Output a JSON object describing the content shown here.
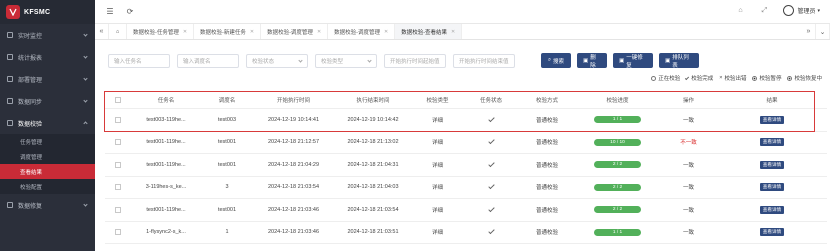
{
  "app": {
    "logo": "KFSMC"
  },
  "sidebar": {
    "items": [
      {
        "label": "实时监控"
      },
      {
        "label": "统计报表"
      },
      {
        "label": "部署管理"
      },
      {
        "label": "数据同步"
      },
      {
        "label": "数据校验"
      },
      {
        "label": "数据修复"
      }
    ],
    "sub_items": [
      {
        "label": "任务管理"
      },
      {
        "label": "调度管理"
      },
      {
        "label": "查看结果"
      },
      {
        "label": "校验配置"
      }
    ]
  },
  "topbar": {
    "user": "管理员"
  },
  "tabs": [
    {
      "label": "数据校验-任务管理"
    },
    {
      "label": "数据校验-新建任务"
    },
    {
      "label": "数据校验-调度管理"
    },
    {
      "label": "数据校验-调度管理"
    },
    {
      "label": "数据校验-查看结果"
    }
  ],
  "filters": {
    "task_name": "输入任务名",
    "sched_name": "输入调度名",
    "check_status": "校验状态",
    "check_type": "校验类型",
    "start_time": "开始执行时间起始值",
    "end_time": "开始执行时间结束值"
  },
  "buttons": {
    "search": "搜索",
    "delete": "删除",
    "repair": "一键修复",
    "queue": "排队列表"
  },
  "legend": [
    "正在校验",
    "校验完成",
    "校验出错",
    "校验暂停",
    "校验恢复中"
  ],
  "table": {
    "headers": [
      "任务名",
      "调度名",
      "开始执行时间",
      "执行结束时间",
      "校验类型",
      "任务状态",
      "校验方式",
      "校验进度",
      "操作",
      "结果"
    ],
    "rows": [
      {
        "name": "test003-119he...",
        "sched": "test003",
        "start": "2024-12-19 10:14:41",
        "end": "2024-12-19 10:14:42",
        "type": "详细",
        "mode": "普通校验",
        "progress": "1 / 1",
        "op": "一致",
        "op_diff": false,
        "result": "查看详情"
      },
      {
        "name": "test001-119he...",
        "sched": "test001",
        "start": "2024-12-18 21:12:57",
        "end": "2024-12-18 21:13:02",
        "type": "详细",
        "mode": "普通校验",
        "progress": "10 / 10",
        "op": "不一致",
        "op_diff": true,
        "result": "查看详情"
      },
      {
        "name": "test001-119he...",
        "sched": "test001",
        "start": "2024-12-18 21:04:29",
        "end": "2024-12-18 21:04:31",
        "type": "详细",
        "mode": "普通校验",
        "progress": "2 / 2",
        "op": "一致",
        "op_diff": false,
        "result": "查看详情"
      },
      {
        "name": "3-119hes-s_ke...",
        "sched": "3",
        "start": "2024-12-18 21:03:54",
        "end": "2024-12-18 21:04:03",
        "type": "详细",
        "mode": "普通校验",
        "progress": "2 / 2",
        "op": "一致",
        "op_diff": false,
        "result": "查看详情"
      },
      {
        "name": "test001-119he...",
        "sched": "test001",
        "start": "2024-12-18 21:03:46",
        "end": "2024-12-18 21:03:54",
        "type": "详细",
        "mode": "普通校验",
        "progress": "2 / 2",
        "op": "一致",
        "op_diff": false,
        "result": "查看详情"
      },
      {
        "name": "1-flysync2-s_k...",
        "sched": "1",
        "start": "2024-12-18 21:03:46",
        "end": "2024-12-18 21:03:51",
        "type": "详细",
        "mode": "普通校验",
        "progress": "1 / 1",
        "op": "一致",
        "op_diff": false,
        "result": "查看详情"
      }
    ]
  },
  "colors": {
    "accent": "#c92b37",
    "button": "#2f4a7f",
    "progress": "#52b05a",
    "diff": "#d92b2b"
  }
}
